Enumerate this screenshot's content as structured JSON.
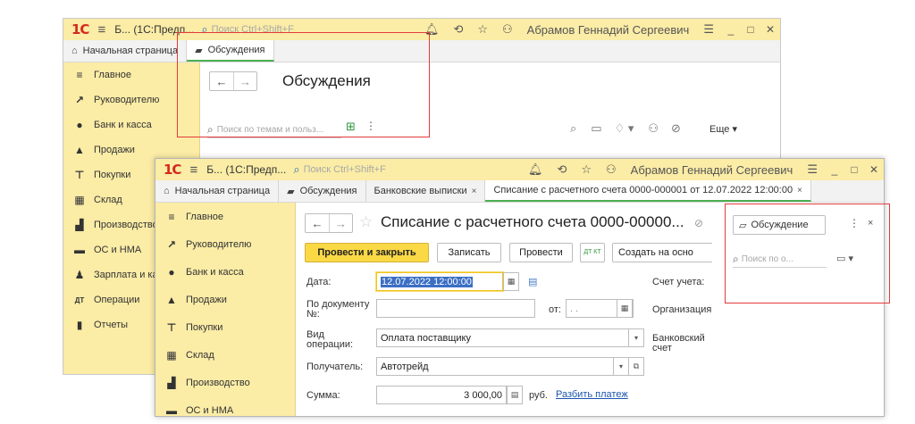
{
  "back_window": {
    "title_bar": {
      "logo": "1C",
      "menu_icon": "≡",
      "app_title": "Б... (1С:Предп...",
      "search_placeholder": "Поиск Ctrl+Shift+F",
      "user_name": "Абрамов Геннадий Сергеевич"
    },
    "tabs": [
      {
        "label": "Начальная страница",
        "icon": "home-icon"
      },
      {
        "label": "Обсуждения",
        "icon": "discussion-icon"
      }
    ],
    "sidebar": [
      {
        "label": "Главное",
        "icon": "menu-icon"
      },
      {
        "label": "Руководителю",
        "icon": "trend-icon"
      },
      {
        "label": "Банк и касса",
        "icon": "coin-icon"
      },
      {
        "label": "Продажи",
        "icon": "cart-icon"
      },
      {
        "label": "Покупки",
        "icon": "basket-icon"
      },
      {
        "label": "Склад",
        "icon": "warehouse-icon"
      },
      {
        "label": "Производство",
        "icon": "factory-icon"
      },
      {
        "label": "ОС и НМА",
        "icon": "truck-icon"
      },
      {
        "label": "Зарплата и ка",
        "icon": "person-icon"
      },
      {
        "label": "Операции",
        "icon": "dt-kt-icon"
      },
      {
        "label": "Отчеты",
        "icon": "chart-icon"
      }
    ],
    "form_title": "Обсуждения",
    "search_placeholder": "Поиск по темам и польз...",
    "more_label": "Еще ▾"
  },
  "front_window": {
    "title_bar": {
      "logo": "1C",
      "menu_icon": "≡",
      "app_title": "Б... (1С:Предп...",
      "search_placeholder": "Поиск Ctrl+Shift+F",
      "user_name": "Абрамов Геннадий Сергеевич"
    },
    "tabs": [
      {
        "label": "Начальная страница",
        "icon": "home-icon"
      },
      {
        "label": "Обсуждения",
        "icon": "discussion-icon"
      },
      {
        "label": "Банковские выписки",
        "close": "×"
      },
      {
        "label": "Списание с расчетного счета 0000-000001 от 12.07.2022 12:00:00",
        "close": "×"
      }
    ],
    "sidebar": [
      {
        "label": "Главное",
        "icon": "menu-icon"
      },
      {
        "label": "Руководителю",
        "icon": "trend-icon"
      },
      {
        "label": "Банк и касса",
        "icon": "coin-icon"
      },
      {
        "label": "Продажи",
        "icon": "cart-icon"
      },
      {
        "label": "Покупки",
        "icon": "basket-icon"
      },
      {
        "label": "Склад",
        "icon": "warehouse-icon"
      },
      {
        "label": "Производство",
        "icon": "factory-icon"
      },
      {
        "label": "ОС и НМА",
        "icon": "truck-icon"
      }
    ],
    "form_title": "Списание с расчетного счета 0000-00000...",
    "toolbar": {
      "post_and_close": "Провести и закрыть",
      "save": "Записать",
      "post": "Провести",
      "dt_kt": "ДТ КТ",
      "create_based_on": "Создать на осно"
    },
    "fields": {
      "date_label": "Дата:",
      "date_value": "12.07.2022 12:00:00",
      "doc_number_label": "По документу №:",
      "doc_number_value": "",
      "from_label": "от:",
      "from_value": " .  .",
      "operation_label": "Вид операции:",
      "operation_value": "Оплата поставщику",
      "recipient_label": "Получатель:",
      "recipient_value": "Автотрейд",
      "amount_label": "Сумма:",
      "amount_value": "3 000,00",
      "currency": "руб.",
      "split_payment_link": "Разбить платеж",
      "account_label": "Счет учета:",
      "organization_label": "Организация:",
      "bank_account_label": "Банковский счет"
    },
    "discussion_panel": {
      "button_label": "Обсуждение",
      "search_placeholder": "Поиск по о..."
    }
  },
  "colors": {
    "title_bar": "#fbeca6",
    "primary_button": "#fbd945",
    "highlight_box": "#e23b3b",
    "link": "#1a55b0"
  }
}
